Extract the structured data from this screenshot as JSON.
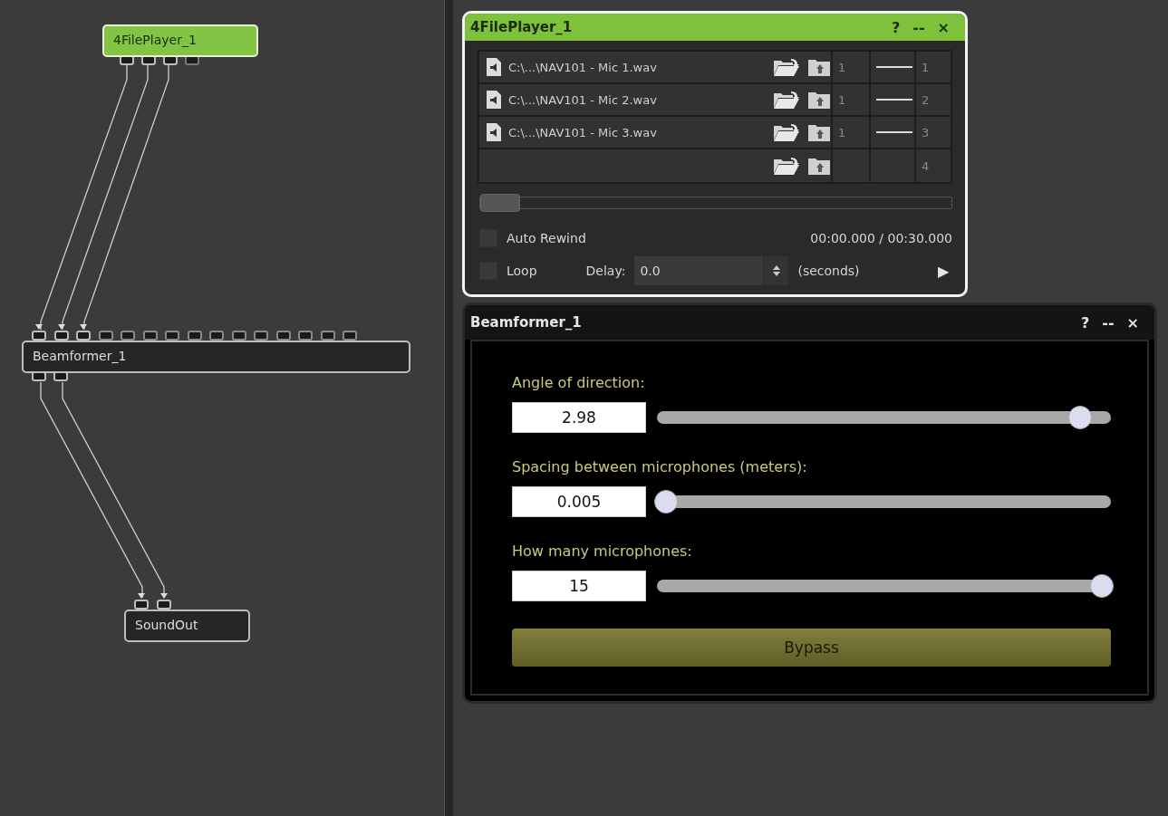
{
  "canvas": {
    "nodes": [
      {
        "name": "4FilePlayer_1",
        "selected": true,
        "outputs": [
          {
            "connected": true
          },
          {
            "connected": true
          },
          {
            "connected": true
          },
          {
            "connected": false
          }
        ]
      },
      {
        "name": "Beamformer_1",
        "selected": false,
        "inputs": [
          {
            "connected": true
          },
          {
            "connected": true
          },
          {
            "connected": true
          },
          {
            "connected": false
          },
          {
            "connected": false
          },
          {
            "connected": false
          },
          {
            "connected": false
          },
          {
            "connected": false
          },
          {
            "connected": false
          },
          {
            "connected": false
          },
          {
            "connected": false
          },
          {
            "connected": false
          },
          {
            "connected": false
          },
          {
            "connected": false
          },
          {
            "connected": false
          }
        ],
        "outputs": [
          {
            "connected": true
          },
          {
            "connected": true
          }
        ]
      },
      {
        "name": "SoundOut",
        "selected": false,
        "inputs": [
          {
            "connected": true
          },
          {
            "connected": true
          }
        ]
      }
    ]
  },
  "file_player": {
    "title": "4FilePlayer_1",
    "selected": true,
    "header_buttons": [
      "?",
      "--",
      "×"
    ],
    "rows": [
      {
        "file": "C:\\...\\NAV101 - Mic 1.wav",
        "channel": "1",
        "output": "1"
      },
      {
        "file": "C:\\...\\NAV101 - Mic 2.wav",
        "channel": "1",
        "output": "2"
      },
      {
        "file": "C:\\...\\NAV101 - Mic 3.wav",
        "channel": "1",
        "output": "3"
      },
      {
        "output": "4"
      }
    ],
    "position": {
      "level": 0.0
    },
    "auto_rewind": {
      "label": "Auto Rewind",
      "checked": false
    },
    "time": "00:00.000 / 00:30.000",
    "loop": {
      "label": "Loop",
      "checked": false
    },
    "delay": {
      "label": "Delay:",
      "value": "0.0",
      "unit": "(seconds)"
    },
    "play": "▶"
  },
  "beamformer": {
    "title": "Beamformer_1",
    "selected": false,
    "header_buttons": [
      "?",
      "--",
      "×"
    ],
    "params": [
      {
        "label": "Angle of direction:",
        "value": "2.98",
        "level": 0.95
      },
      {
        "label": "Spacing between microphones (meters):",
        "value": "0.005",
        "level": 0.0
      },
      {
        "label": "How many microphones:",
        "value": "15",
        "level": 1.0
      }
    ],
    "bypass": "Bypass"
  }
}
